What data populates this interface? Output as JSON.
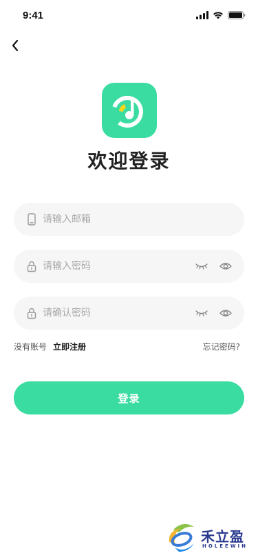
{
  "status_bar": {
    "time": "9:41"
  },
  "title": "欢迎登录",
  "form": {
    "email_placeholder": "请输入邮箱",
    "password_placeholder": "请输入密码",
    "confirm_placeholder": "请确认密码"
  },
  "links": {
    "no_account": "没有账号",
    "register": "立即注册",
    "forgot": "忘记密码?"
  },
  "login_button": "登录",
  "watermark": {
    "name": "禾立盈",
    "sub": "HOLEEWIN"
  },
  "colors": {
    "accent": "#3bdca2",
    "input_bg": "#f6f6f6",
    "logo_yellow": "#f5d81c"
  }
}
